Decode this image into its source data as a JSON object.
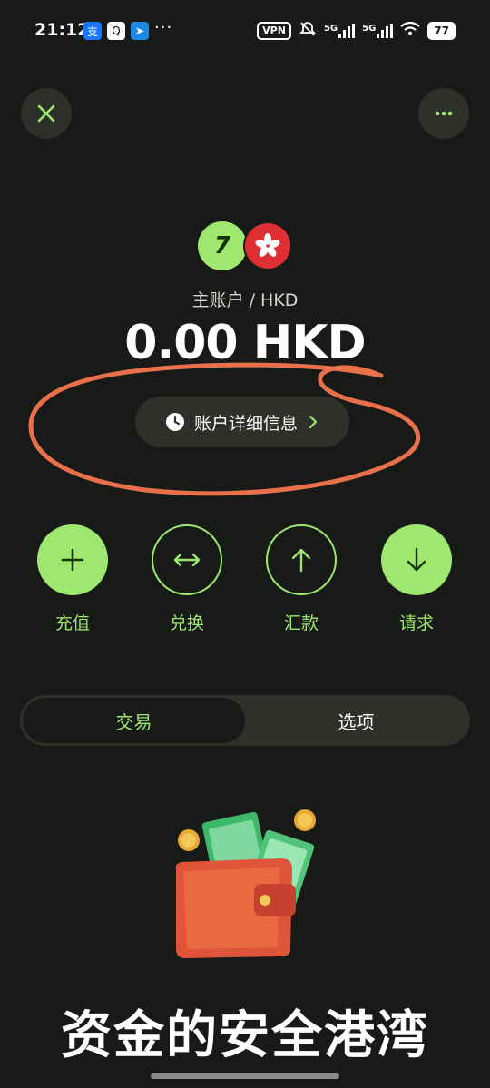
{
  "status_bar": {
    "time": "21:12",
    "more": "···",
    "vpn": "VPN",
    "network1": "5G",
    "network2": "5G",
    "battery": "77"
  },
  "account": {
    "label": "主账户 / HKD",
    "balance": "0.00 HKD",
    "details_label": "账户详细信息",
    "brand_glyph": "7"
  },
  "actions": [
    {
      "label": "充值"
    },
    {
      "label": "兑换"
    },
    {
      "label": "汇款"
    },
    {
      "label": "请求"
    }
  ],
  "tabs": [
    {
      "label": "交易",
      "active": true
    },
    {
      "label": "选项",
      "active": false
    }
  ],
  "hero": {
    "title": "资金的安全港湾"
  },
  "colors": {
    "background": "#181a17",
    "accent": "#9fe870",
    "surface": "#2e302c",
    "annotation": "#e8704a",
    "hk_red": "#de2f35"
  }
}
